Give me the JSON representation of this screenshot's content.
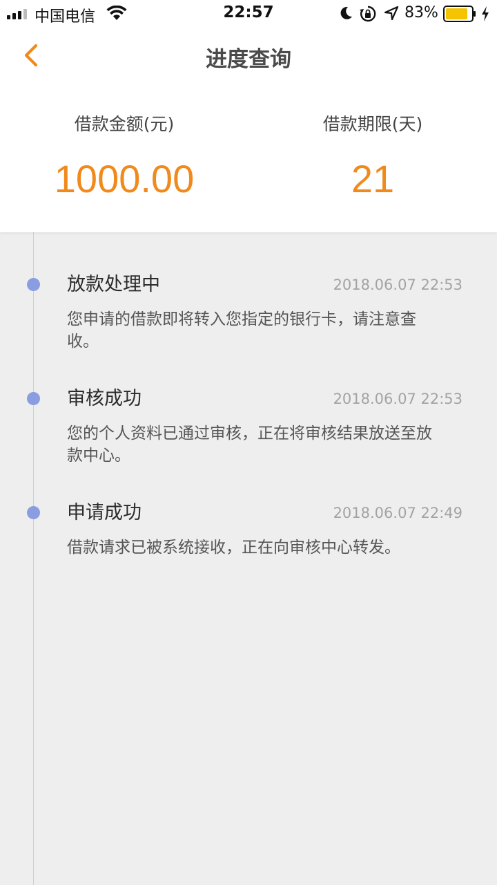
{
  "status_bar": {
    "carrier": "中国电信",
    "time": "22:57",
    "battery_percent": "83%",
    "battery_color": "#f5c400",
    "icons": [
      "signal-icon",
      "wifi-icon",
      "moon-icon",
      "rotation-lock-icon",
      "location-icon",
      "battery-icon",
      "charging-icon"
    ]
  },
  "nav": {
    "back_icon": "chevron-left-icon",
    "title": "进度查询",
    "accent_color": "#f08a1c"
  },
  "summary": {
    "amount_label": "借款金额(元)",
    "amount_value": "1000.00",
    "term_label": "借款期限(天)",
    "term_value": "21",
    "value_color": "#f08a1c"
  },
  "timeline": {
    "dot_color": "#8a9de0",
    "items": [
      {
        "title": "放款处理中",
        "time": "2018.06.07 22:53",
        "desc": "您申请的借款即将转入您指定的银行卡，请注意查收。"
      },
      {
        "title": "审核成功",
        "time": "2018.06.07 22:53",
        "desc": "您的个人资料已通过审核，正在将审核结果放送至放款中心。"
      },
      {
        "title": "申请成功",
        "time": "2018.06.07 22:49",
        "desc": "借款请求已被系统接收，正在向审核中心转发。"
      }
    ]
  }
}
